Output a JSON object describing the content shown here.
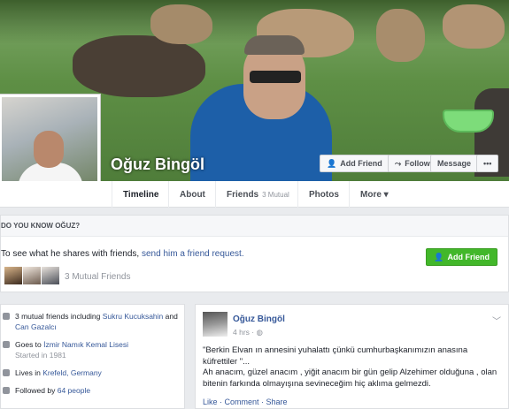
{
  "profile": {
    "name": "Oğuz Bingöl"
  },
  "cover_buttons": {
    "add_friend": "Add Friend",
    "follow": "Follow",
    "message": "Message",
    "more": "•••"
  },
  "nav": {
    "timeline": "Timeline",
    "about": "About",
    "friends": "Friends",
    "friends_sub": "3 Mutual",
    "photos": "Photos",
    "more": "More ▾"
  },
  "know": {
    "title": "DO YOU KNOW OĞUZ?",
    "text": "To see what he shares with friends, ",
    "link": "send him a friend request.",
    "add_button": "Add Friend",
    "mutual_label": "3 Mutual Friends"
  },
  "intro": {
    "mutual_prefix": "3 mutual friends including ",
    "mutual_a": "Sukru Kucuksahin",
    "mutual_and": " and ",
    "mutual_b": "Can Gazalcı",
    "school_prefix": "Goes to ",
    "school": "İzmir Namık Kemal Lisesi",
    "school_sub": "Started in 1981",
    "lives_prefix": "Lives in ",
    "lives": "Krefeld, Germany",
    "followed_prefix": "Followed by ",
    "followed": "64 people"
  },
  "post": {
    "author": "Oğuz Bingöl",
    "time": "4 hrs · ",
    "body_1": "\"Berkin Elvan ın annesini yuhalattı çünkü cumhurbaşkanımızın anasına küfrettiler \"...",
    "body_2": "Ah anacım, güzel anacım , yiğit anacım bir gün gelip Alzehimer olduğuna , olan bitenin farkında olmayışına sevineceğim hiç aklıma gelmezdi.",
    "actions": "Like · Comment · Share"
  },
  "colors": {
    "link": "#365899",
    "green": "#42b72a"
  }
}
